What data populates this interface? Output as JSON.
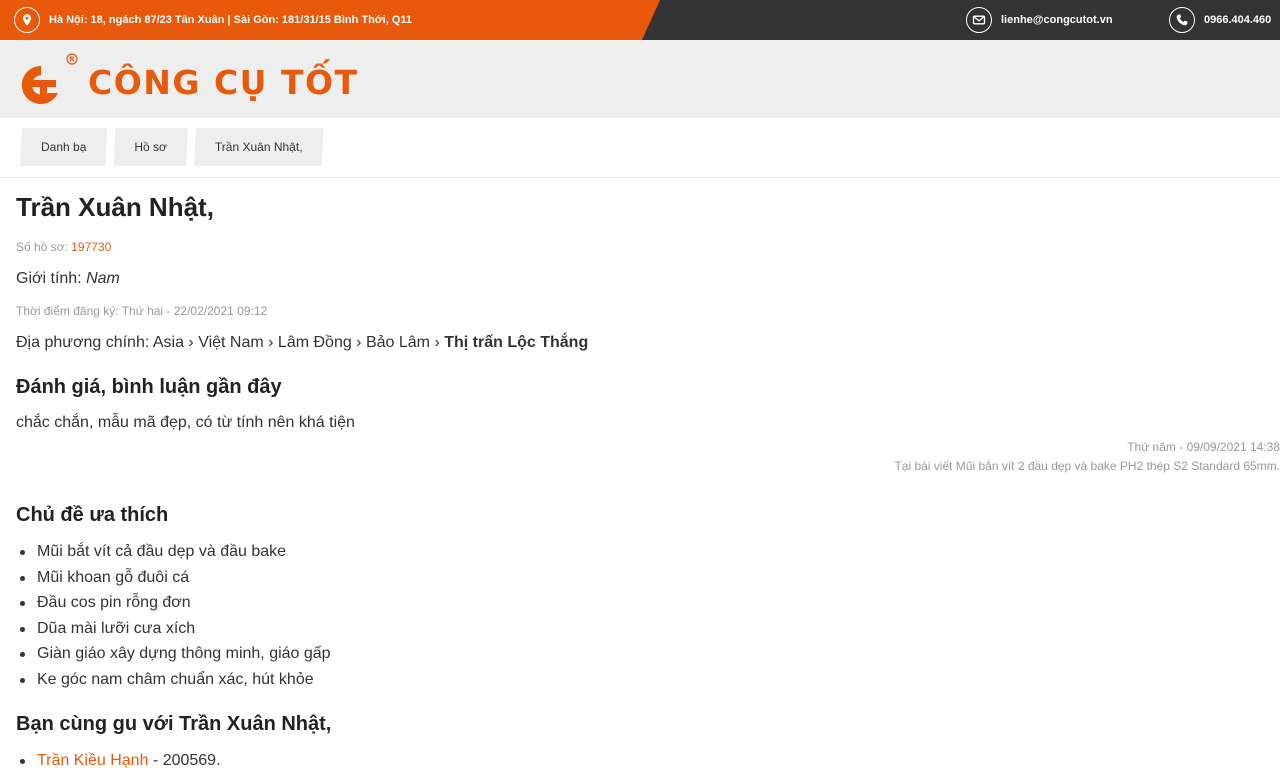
{
  "topbar": {
    "address": "Hà Nội: 18, ngách 87/23 Tân Xuân | Sài Gòn: 181/31/15 Bình Thới, Q11",
    "email": "lienhe@congcutot.vn",
    "phone": "0966.404.460",
    "colors": {
      "orange": "#e8590c",
      "dark": "#333333"
    }
  },
  "logo": {
    "text": "CÔNG CỤ TỐT",
    "mark_icon": "ct-logo-mark"
  },
  "breadcrumb": [
    "Danh bạ",
    "Hồ sơ",
    "Trần Xuân Nhật,"
  ],
  "profile": {
    "name": "Trần Xuân Nhật,",
    "id_label": "Số hồ sơ: ",
    "id": "197730",
    "gender_label": "Giới tính: ",
    "gender": "Nam",
    "registered": "Thời điểm đăng ký: Thứ hai - 22/02/2021 09:12",
    "locale_label": "Địa phương chính: Asia › Việt Nam › Lâm Đồng › Bảo Lâm › ",
    "locale_last": "Thị trấn Lộc Thắng"
  },
  "reviews": {
    "heading": "Đánh giá, bình luận gần đây",
    "text": "chắc chắn, mẫu mã đẹp, có từ tính nên khá tiện",
    "time": "Thứ năm - 09/09/2021 14:38",
    "source": "Tại bài viết Mũi bắn vít 2 đầu dẹp và bake PH2 thép S2 Standard 65mm."
  },
  "favorites": {
    "heading": "Chủ đề ưa thích",
    "items": [
      "Mũi bắt vít cả đầu dẹp và đầu bake",
      "Mũi khoan gỗ đuôi cá",
      "Đầu cos pin rỗng đơn",
      "Dũa mài lưỡi cưa xích",
      "Giàn giáo xây dựng thông minh, giáo gấp",
      "Ke góc nam châm chuẩn xác, hút khỏe"
    ]
  },
  "peers": {
    "heading": "Bạn cùng gu với Trần Xuân Nhật,",
    "items": [
      {
        "name": "Trần Kiều Hạnh",
        "suffix": " - 200569."
      }
    ]
  }
}
